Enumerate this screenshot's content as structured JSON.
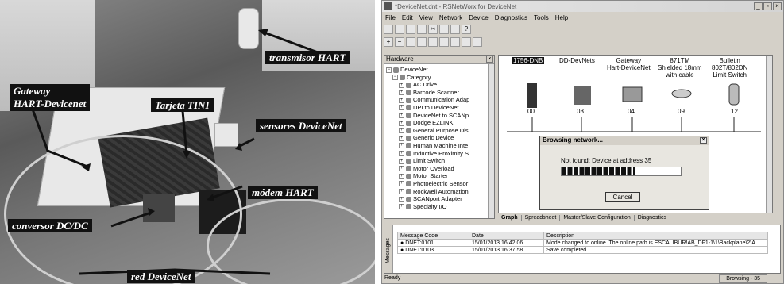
{
  "photo": {
    "labels": {
      "transmisor": "transmisor HART",
      "gateway": "Gateway\nHART-Devicenet",
      "tini": "Tarjeta TINI",
      "sensores": "sensores DeviceNet",
      "modem": "módem HART",
      "conversor": "conversor DC/DC",
      "red": "red DeviceNet"
    }
  },
  "app": {
    "title": "*DeviceNet.dnt - RSNetWorx for DeviceNet",
    "menu": [
      "File",
      "Edit",
      "View",
      "Network",
      "Device",
      "Diagnostics",
      "Tools",
      "Help"
    ],
    "hardware_header": "Hardware",
    "tree": [
      {
        "label": "DeviceNet",
        "exp": "−",
        "indent": 0
      },
      {
        "label": "Category",
        "exp": "−",
        "indent": 1
      },
      {
        "label": "AC Drive",
        "exp": "+",
        "indent": 2
      },
      {
        "label": "Barcode Scanner",
        "exp": "+",
        "indent": 2
      },
      {
        "label": "Communication Adap",
        "exp": "+",
        "indent": 2
      },
      {
        "label": "DPI to DeviceNet",
        "exp": "+",
        "indent": 2
      },
      {
        "label": "DeviceNet to SCANp",
        "exp": "+",
        "indent": 2
      },
      {
        "label": "Dodge EZLINK",
        "exp": "+",
        "indent": 2
      },
      {
        "label": "General Purpose Dis",
        "exp": "+",
        "indent": 2
      },
      {
        "label": "Generic Device",
        "exp": "+",
        "indent": 2
      },
      {
        "label": "Human Machine Inte",
        "exp": "+",
        "indent": 2
      },
      {
        "label": "Inductive Proximity S",
        "exp": "+",
        "indent": 2
      },
      {
        "label": "Limit Switch",
        "exp": "+",
        "indent": 2
      },
      {
        "label": "Motor Overload",
        "exp": "+",
        "indent": 2
      },
      {
        "label": "Motor Starter",
        "exp": "+",
        "indent": 2
      },
      {
        "label": "Photoelectric Sensor",
        "exp": "+",
        "indent": 2
      },
      {
        "label": "Rockwell Automation",
        "exp": "+",
        "indent": 2
      },
      {
        "label": "SCANport Adapter",
        "exp": "+",
        "indent": 2
      },
      {
        "label": "Specialty I/O",
        "exp": "+",
        "indent": 2
      }
    ],
    "devices": [
      {
        "name": "1756-DNB",
        "addr": "00"
      },
      {
        "name": "DD-DevNets",
        "addr": "03"
      },
      {
        "name": "Gateway\nHart-DeviceNet",
        "addr": "04"
      },
      {
        "name": "871TM\nShielded 18mm\nwith cable",
        "addr": "09"
      },
      {
        "name": "Bulletin\n802T/802DN\nLimit Switch",
        "addr": "12"
      }
    ],
    "tabs": [
      "Graph",
      "Spreadsheet",
      "Master/Slave Configuration",
      "Diagnostics"
    ],
    "dialog": {
      "title": "Browsing network...",
      "message": "Not found: Device at address 35",
      "progress": 0.62,
      "cancel": "Cancel"
    },
    "messages_label": "Messages",
    "messages": {
      "headers": [
        "Message Code",
        "Date",
        "Description"
      ],
      "rows": [
        [
          "DNET:0101",
          "15/01/2013 16:42:06",
          "Mode changed to online.  The online path is ESCALIBUR!AB_DF1-1\\1\\Backplane\\2\\A."
        ],
        [
          "DNET:0103",
          "15/01/2013 16:37:58",
          "Save completed."
        ]
      ]
    },
    "status_left": "Ready",
    "status_right": "Browsing - 35"
  }
}
